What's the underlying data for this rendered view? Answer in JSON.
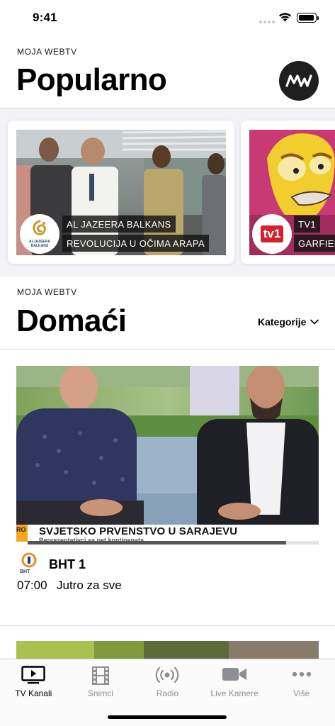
{
  "status_bar": {
    "time": "9:41"
  },
  "popular": {
    "kicker": "MOJA WEBTV",
    "title": "Popularno",
    "logo_text": "MW",
    "cards": [
      {
        "channel": "AL JAZEERA BALKANS",
        "program": "REVOLUCIJA U OČIMA ARAPA",
        "logo_text": "ALJAZEERA BALKANS"
      },
      {
        "channel": "TV1",
        "program": "GARFIELD",
        "logo_text": "tv1"
      }
    ]
  },
  "domestic": {
    "kicker": "MOJA WEBTV",
    "title": "Domaći",
    "category_label": "Kategorije",
    "program": {
      "ticker_left": "RO",
      "headline": "SVJETSKO PRVENSTVO U SARAJEVU",
      "subheadline": "Reprezentativci sa pet kontinenata",
      "channel": "BHT 1",
      "channel_logo_text": "BHT",
      "time": "07:00",
      "title": "Jutro za sve"
    }
  },
  "tab_bar": {
    "tabs": [
      {
        "label": "TV Kanali",
        "icon": "tv-icon",
        "active": true
      },
      {
        "label": "Snimci",
        "icon": "film-icon",
        "active": false
      },
      {
        "label": "Radio",
        "icon": "radio-icon",
        "active": false
      },
      {
        "label": "Live Kamere",
        "icon": "video-camera-icon",
        "active": false
      },
      {
        "label": "Više",
        "icon": "more-icon",
        "active": false
      }
    ]
  },
  "colors": {
    "tab_active": "#000000",
    "tab_inactive": "#8e8e93",
    "background_band": "#f2f2f7",
    "tv1_red": "#d2232a",
    "aljazeera_gold": "#c89a2a"
  }
}
